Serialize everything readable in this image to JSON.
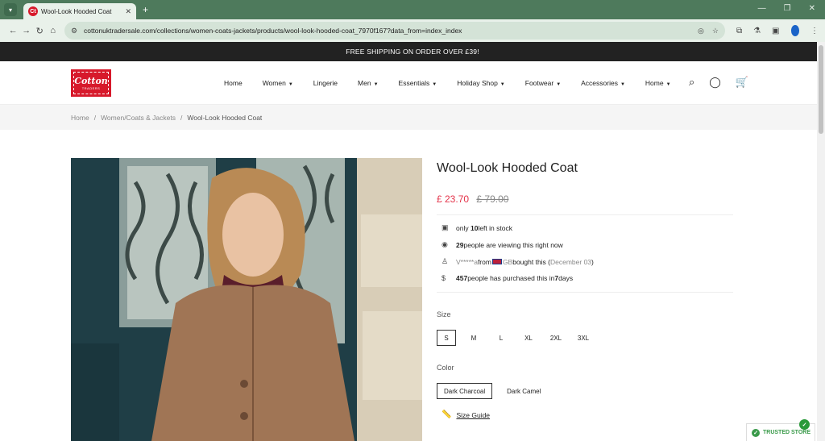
{
  "browser": {
    "tab_title": "Wool-Look Hooded Coat",
    "favicon_text": "Ct",
    "url": "cottonuktradersale.com/collections/women-coats-jackets/products/wool-look-hooded-coat_7970f167?data_from=index_index"
  },
  "announcement": "FREE SHIPPING ON ORDER OVER £39!",
  "logo": {
    "line1": "Cotton",
    "line2": "TRADERS"
  },
  "nav": [
    {
      "label": "Home",
      "dropdown": false
    },
    {
      "label": "Women",
      "dropdown": true
    },
    {
      "label": "Lingerie",
      "dropdown": false
    },
    {
      "label": "Men",
      "dropdown": true
    },
    {
      "label": "Essentials",
      "dropdown": true
    },
    {
      "label": "Holiday Shop",
      "dropdown": true
    },
    {
      "label": "Footwear",
      "dropdown": true
    },
    {
      "label": "Accessories",
      "dropdown": true
    },
    {
      "label": "Home",
      "dropdown": true
    }
  ],
  "breadcrumb": {
    "home": "Home",
    "category": "Women/Coats & Jackets",
    "current": "Wool-Look Hooded Coat"
  },
  "product": {
    "title": "Wool-Look Hooded Coat",
    "price": "£ 23.70",
    "old_price": "£ 79.00",
    "stock": {
      "pre": "only ",
      "count": "10",
      "post": " left in stock"
    },
    "viewing": {
      "count": "29",
      "post": " people are viewing this right now"
    },
    "recent": {
      "name": "V*****a",
      "from": " from ",
      "country": "GB",
      "bought": " bought this (",
      "date": "December 03",
      "close": ")"
    },
    "purchased": {
      "count": "457",
      "mid": " people has purchased this in ",
      "days": "7",
      "post": " days"
    },
    "size_label": "Size",
    "sizes": [
      "S",
      "M",
      "L",
      "XL",
      "2XL",
      "3XL"
    ],
    "selected_size": "S",
    "color_label": "Color",
    "colors": [
      "Dark Charcoal",
      "Dark Camel"
    ],
    "selected_color": "Dark Charcoal",
    "size_guide": "Size Guide"
  },
  "trusted_badge": "TRUSTED STORE",
  "colors": {
    "accent": "#e4334a",
    "brand": "#d7192b",
    "chrome": "#4e7a5c"
  }
}
